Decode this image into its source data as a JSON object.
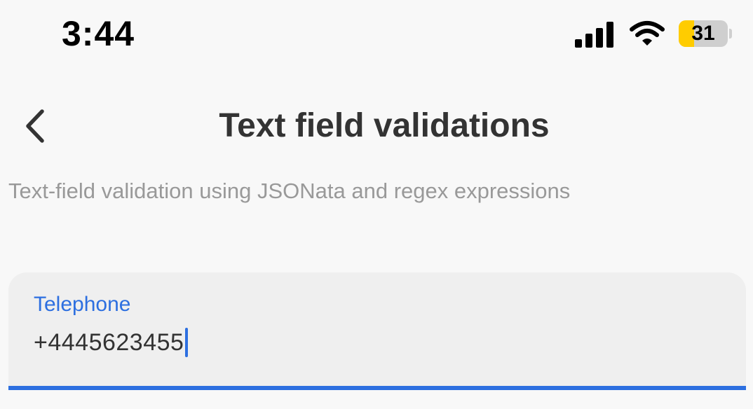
{
  "status_bar": {
    "time": "3:44",
    "signal_bars": 4,
    "battery_level": "31",
    "battery_fraction": 0.31,
    "battery_color": "#ffcc00"
  },
  "header": {
    "back_icon": "chevron-left-icon",
    "title": "Text field validations"
  },
  "content": {
    "description": "Text-field validation using JSONata and regex expressions",
    "telephone_field": {
      "label": "Telephone",
      "value": "+4445623455",
      "focused": true,
      "accent_color": "#2d6fe0"
    }
  }
}
